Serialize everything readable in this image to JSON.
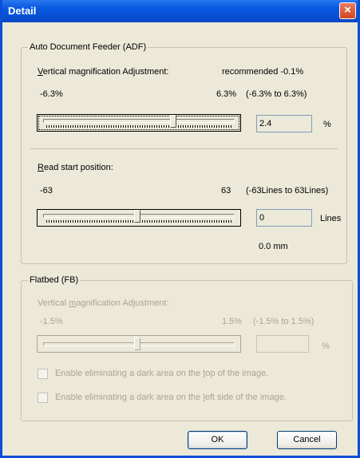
{
  "window": {
    "title": "Detail",
    "close_glyph": "×"
  },
  "adf": {
    "legend": "Auto Document Feeder (ADF)",
    "vertical_label": "Vertical magnification Adjustment:",
    "recommended": "recommended  -0.1%",
    "min_label": "-6.3%",
    "max_label": "6.3%",
    "range_label": "(-6.3% to 6.3%)",
    "vertical_value": "2.4",
    "vertical_unit": "%",
    "read_start_label": "Read start position:",
    "read_min": "-63",
    "read_max": "63",
    "read_range": "(-63Lines to 63Lines)",
    "read_value": "0",
    "read_unit": "Lines",
    "read_mm": "0.0 mm"
  },
  "fb": {
    "legend": "Flatbed (FB)",
    "vertical_label": "Vertical magnification Adjustment:",
    "min_label": "-1.5%",
    "max_label": "1.5%",
    "range_label": "(-1.5% to 1.5%)",
    "vertical_value": "",
    "vertical_unit": "%",
    "check_top": "Enable eliminating a dark area on the top of the image.",
    "check_left": "Enable eliminating a dark area on the left side of the image."
  },
  "sliders": {
    "adf_vertical": 0.69,
    "adf_read": 0.5,
    "fb_vertical": 0.5
  },
  "buttons": {
    "ok": "OK",
    "cancel": "Cancel"
  }
}
